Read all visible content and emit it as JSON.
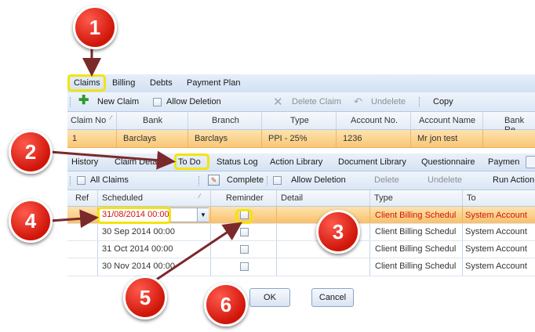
{
  "menu": {
    "items": [
      "Claims",
      "Billing",
      "Debts",
      "Payment Plan"
    ]
  },
  "toolbar": {
    "new_claim": "New Claim",
    "allow_deletion": "Allow Deletion",
    "delete_claim": "Delete Claim",
    "undelete": "Undelete",
    "copy": "Copy"
  },
  "claims_grid": {
    "headers": [
      "Claim No",
      "Bank",
      "Branch",
      "Type",
      "Account No.",
      "Account Name",
      "Bank Re"
    ],
    "row": [
      "1",
      "Barclays",
      "Barclays",
      "PPI - 25%",
      "1236",
      "Mr jon test",
      ""
    ]
  },
  "tabs": [
    "History",
    "Claim Details",
    "To Do",
    "Status Log",
    "Action Library",
    "Document Library",
    "Questionnaire",
    "Paymen"
  ],
  "todo_toolbar": {
    "all_claims": "All Claims",
    "complete": "Complete",
    "allow_deletion": "Allow Deletion",
    "delete": "Delete",
    "undelete": "Undelete",
    "run_action": "Run Action"
  },
  "todo_grid": {
    "headers": [
      "Ref",
      "Scheduled",
      "Reminder",
      "Detail",
      "Type",
      "To"
    ],
    "rows": [
      {
        "scheduled": "31/08/2014 00:00",
        "type": "Client Billing Schedul",
        "to": "System Account"
      },
      {
        "scheduled": "30 Sep 2014 00:00",
        "type": "Client Billing Schedul",
        "to": "System Account"
      },
      {
        "scheduled": "31 Oct 2014 00:00",
        "type": "Client Billing Schedul",
        "to": "System Account"
      },
      {
        "scheduled": "30 Nov 2014 00:00",
        "type": "Client Billing Schedul",
        "to": "System Account"
      }
    ]
  },
  "buttons": {
    "ok": "OK",
    "cancel": "Cancel"
  },
  "callouts": [
    "1",
    "2",
    "3",
    "4",
    "5",
    "6"
  ],
  "colors": {
    "callout": "#d01509",
    "highlight": "#f2e40c",
    "selected_row": "#f9c774",
    "arrow": "#7a2a2a"
  }
}
